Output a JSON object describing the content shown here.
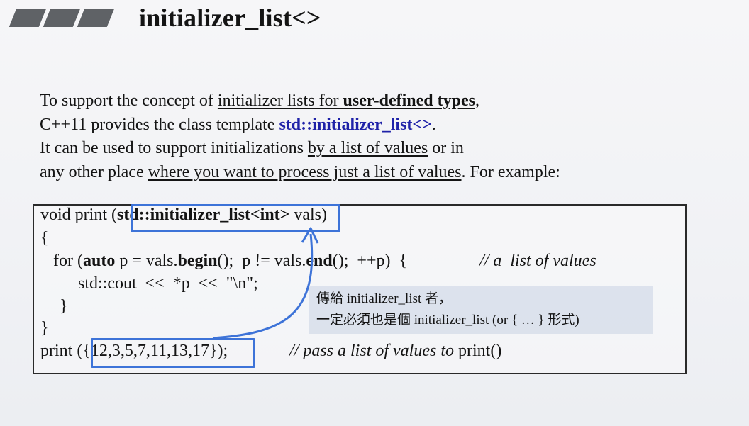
{
  "title": "initializer_list<>",
  "intro": {
    "l1_a": "To support the concept of ",
    "l1_u": "initializer lists for ",
    "l1_ub": "user-defined types",
    "l1_c": ",",
    "l2_a": "C++11 provides the class template ",
    "l2_blue": "std::initializer_list<>",
    "l2_c": ".",
    "l3_a": "It can be used to support initializations ",
    "l3_u": "by a list of values",
    "l3_c": " or in",
    "l4_a": "any other place ",
    "l4_u": "where you want to process just a list of values",
    "l4_c": ". For example:"
  },
  "code": {
    "l1_a": "void print (",
    "l1_b": "std::initializer_list<int>",
    "l1_c": " vals)",
    "l2": "{",
    "l3_a": "   for (",
    "l3_auto": "auto",
    "l3_b": " p = vals.",
    "l3_begin": "begin",
    "l3_c": "();  p != vals.",
    "l3_end": "end",
    "l3_d": "();  ++p)  {",
    "l3_comment": "// a  list of values",
    "l4": "std::cout  <<  *p  <<  \"\\n\";",
    "l5": "}",
    "l6": "}",
    "l7_a": "print (",
    "l7_b": "{12,3,5,7,11,13,17}",
    "l7_c": ");",
    "l7_comment": "// pass a list of values to ",
    "l7_fn": "print()"
  },
  "note": {
    "line1": "傳給 initializer_list 者，",
    "line2": "一定必須也是個 initializer_list (or { … } 形式)"
  },
  "colors": {
    "accent_blue": "#3d73d8",
    "keyword_blue": "#1f22a8",
    "bars": "#5f6266"
  }
}
